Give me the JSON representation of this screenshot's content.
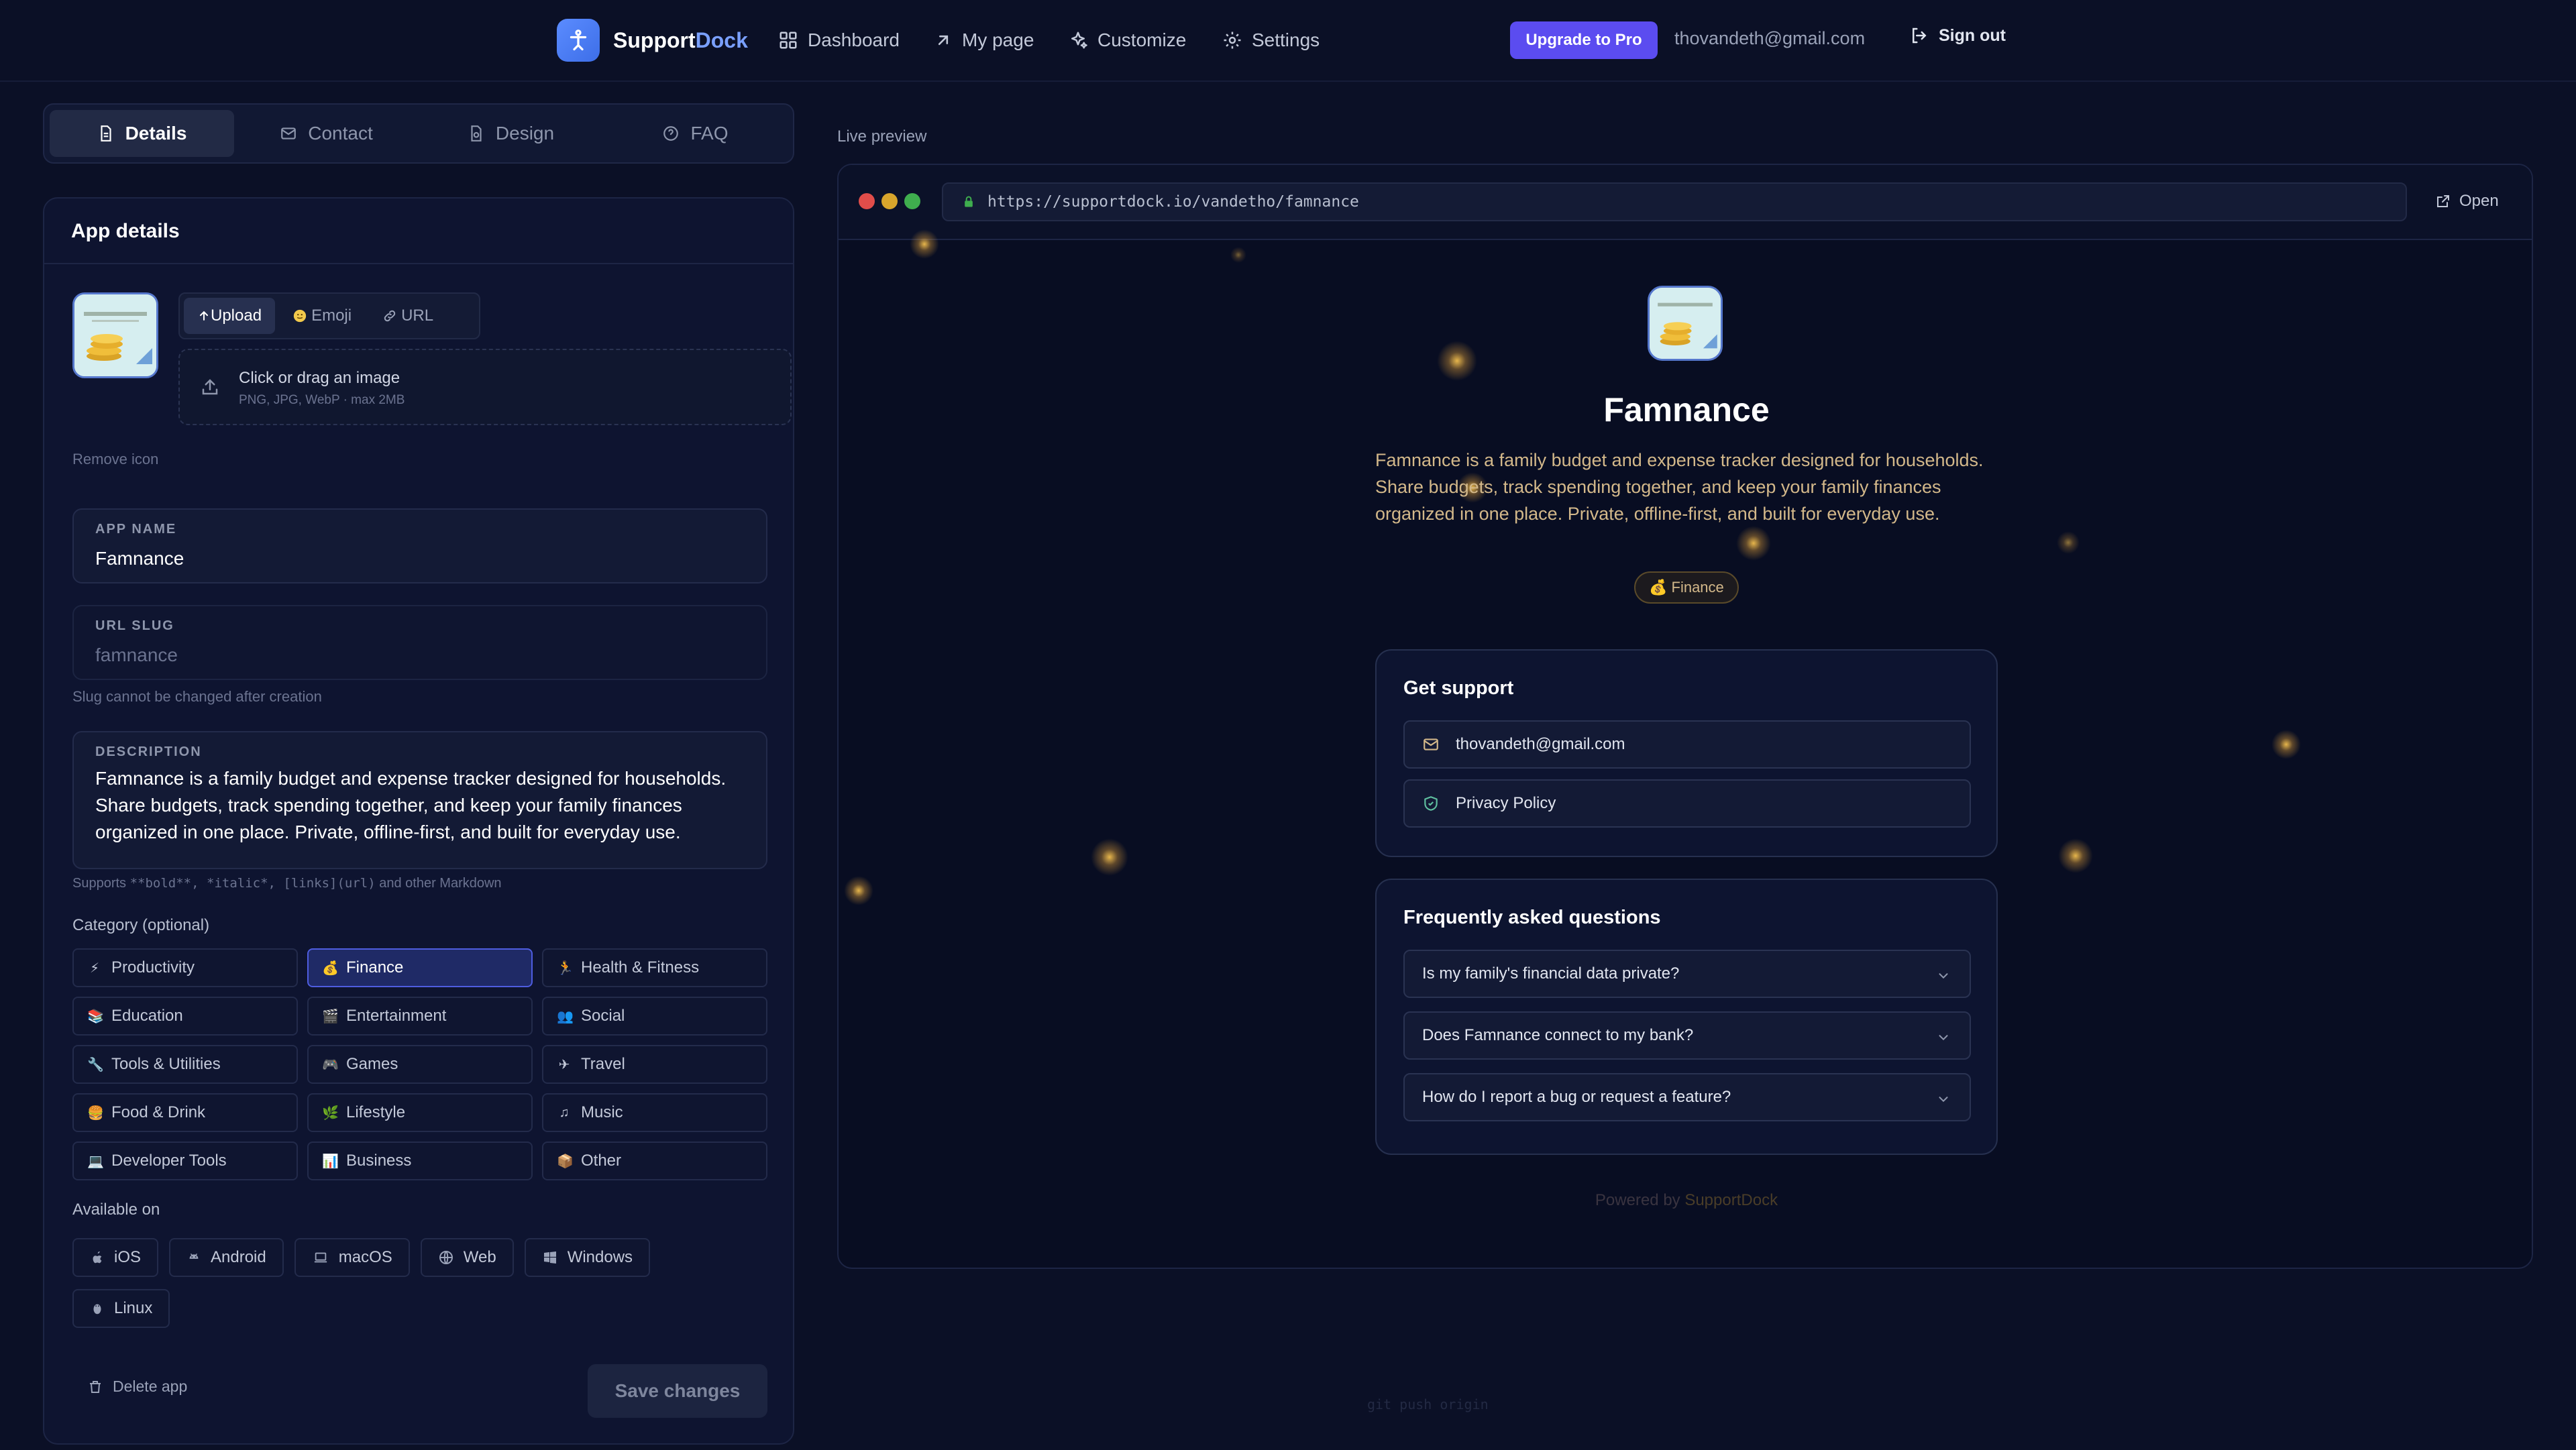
{
  "header": {
    "brand_part1": "Support",
    "brand_part2": "Dock",
    "nav": [
      {
        "label": "Dashboard",
        "icon": "grid-icon"
      },
      {
        "label": "My page",
        "icon": "arrow-up-right-icon"
      },
      {
        "label": "Customize",
        "icon": "sparkles-icon"
      },
      {
        "label": "Settings",
        "icon": "gear-icon"
      }
    ],
    "upgrade_label": "Upgrade to Pro",
    "user_email": "thovandeth@gmail.com",
    "signout_label": "Sign out"
  },
  "tabs": [
    {
      "label": "Details",
      "active": true
    },
    {
      "label": "Contact",
      "active": false
    },
    {
      "label": "Design",
      "active": false
    },
    {
      "label": "FAQ",
      "active": false
    }
  ],
  "panel": {
    "title": "App details",
    "icon_source_tabs": [
      "Upload",
      "Emoji",
      "URL"
    ],
    "dropzone_title": "Click or drag an image",
    "dropzone_sub": "PNG, JPG, WebP · max 2MB",
    "remove_icon": "Remove icon",
    "app_name_label": "APP NAME",
    "app_name_value": "Famnance",
    "slug_label": "URL SLUG",
    "slug_value": "famnance",
    "slug_hint": "Slug cannot be changed after creation",
    "description_label": "DESCRIPTION",
    "description_value": "Famnance is a family budget and expense tracker designed for households. Share budgets, track spending together, and keep your family finances organized in one place. Private, offline-first, and built for everyday use.",
    "markdown_hint_prefix": "Supports ",
    "markdown_hint_code": "**bold**, *italic*, [links](url)",
    "markdown_hint_suffix": " and other Markdown",
    "category_label": "Category (optional)",
    "categories": [
      {
        "label": "Productivity",
        "emoji": "⚡",
        "selected": false
      },
      {
        "label": "Finance",
        "emoji": "💰",
        "selected": true
      },
      {
        "label": "Health & Fitness",
        "emoji": "🏃",
        "selected": false
      },
      {
        "label": "Education",
        "emoji": "📚",
        "selected": false
      },
      {
        "label": "Entertainment",
        "emoji": "🎬",
        "selected": false
      },
      {
        "label": "Social",
        "emoji": "👥",
        "selected": false
      },
      {
        "label": "Tools & Utilities",
        "emoji": "🔧",
        "selected": false
      },
      {
        "label": "Games",
        "emoji": "🎮",
        "selected": false
      },
      {
        "label": "Travel",
        "emoji": "✈",
        "selected": false
      },
      {
        "label": "Food & Drink",
        "emoji": "🍔",
        "selected": false
      },
      {
        "label": "Lifestyle",
        "emoji": "🌿",
        "selected": false
      },
      {
        "label": "Music",
        "emoji": "♫",
        "selected": false
      },
      {
        "label": "Developer Tools",
        "emoji": "💻",
        "selected": false
      },
      {
        "label": "Business",
        "emoji": "📊",
        "selected": false
      },
      {
        "label": "Other",
        "emoji": "📦",
        "selected": false
      }
    ],
    "platforms_label": "Available on",
    "platforms": [
      "iOS",
      "Android",
      "macOS",
      "Web",
      "Windows",
      "Linux"
    ],
    "delete_label": "Delete app",
    "save_label": "Save changes"
  },
  "preview": {
    "label": "Live preview",
    "url": "https://supportdock.io/vandetho/famnance",
    "open_label": "Open",
    "app_title": "Famnance",
    "description": "Famnance is a family budget and expense tracker designed for households. Share budgets, track spending together, and keep your family finances organized in one place. Private, offline-first, and built for everyday use.",
    "category_badge": "💰 Finance",
    "support_title": "Get support",
    "support_email": "thovandeth@gmail.com",
    "privacy_label": "Privacy Policy",
    "faq_title": "Frequently asked questions",
    "faqs": [
      "Is my family's financial data private?",
      "Does Famnance connect to my bank?",
      "How do I report a bug or request a feature?"
    ],
    "powered_prefix": "Powered by ",
    "powered_brand": "SupportDock"
  },
  "footer_hint": "git push origin",
  "colors": {
    "background": "#0b1026",
    "accent": "#5b4cf0",
    "brand_blue": "#7aa0ff",
    "preview_text": "#d3b88a"
  }
}
